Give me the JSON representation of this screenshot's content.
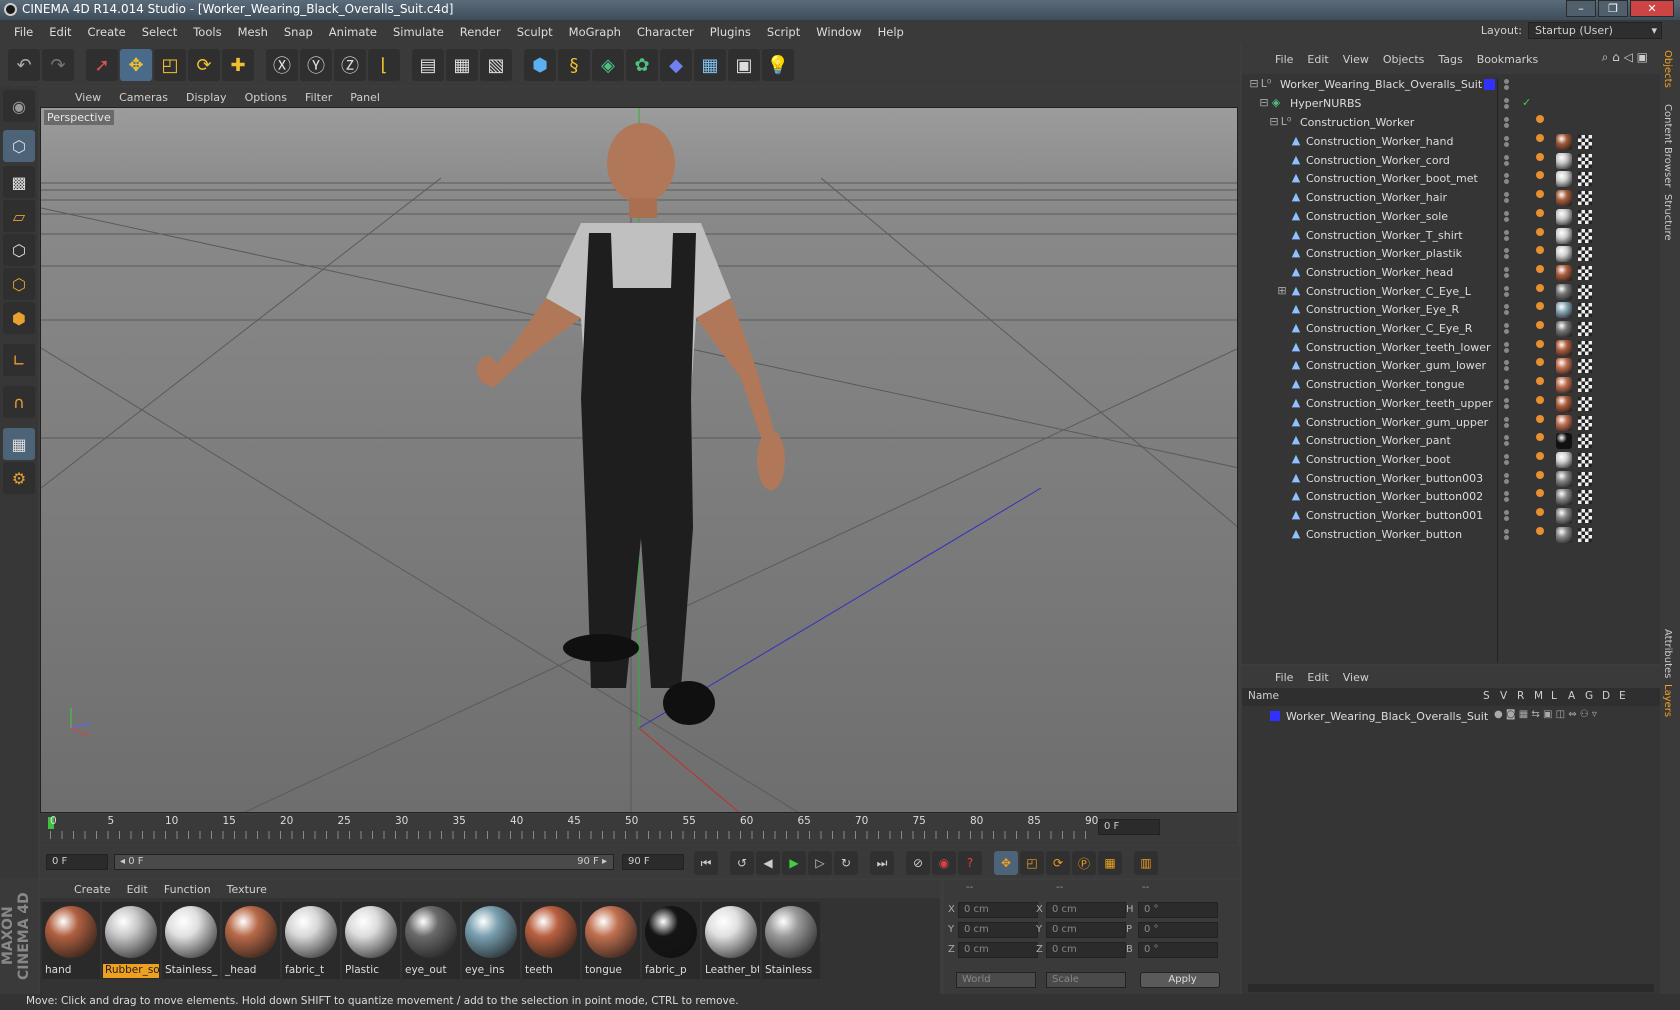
{
  "window": {
    "title": "CINEMA 4D R14.014 Studio - [Worker_Wearing_Black_Overalls_Suit.c4d]",
    "buttons": [
      "–",
      "❐",
      "✕"
    ]
  },
  "menu": [
    "File",
    "Edit",
    "Create",
    "Select",
    "Tools",
    "Mesh",
    "Snap",
    "Animate",
    "Simulate",
    "Render",
    "Sculpt",
    "MoGraph",
    "Character",
    "Plugins",
    "Script",
    "Window",
    "Help"
  ],
  "layout": {
    "label": "Layout:",
    "value": "Startup (User)"
  },
  "viewport": {
    "menu": [
      "View",
      "Cameras",
      "Display",
      "Options",
      "Filter",
      "Panel"
    ],
    "label": "Perspective"
  },
  "timeline": {
    "ticks": [
      "0",
      "5",
      "10",
      "15",
      "20",
      "25",
      "30",
      "35",
      "40",
      "45",
      "50",
      "55",
      "60",
      "65",
      "70",
      "75",
      "80",
      "85",
      "90"
    ],
    "end_field": "0 F"
  },
  "timecontrols": {
    "current": "0 F",
    "range_start": "◂ 0 F",
    "range_end": "90 F ▸",
    "max": "90 F"
  },
  "materials": {
    "menu": [
      "Create",
      "Edit",
      "Function",
      "Texture"
    ],
    "items": [
      {
        "name": "hand",
        "color": "#b06040"
      },
      {
        "name": "Rubber_so",
        "color": "#c8c8c8",
        "active": true
      },
      {
        "name": "Stainless_",
        "color": "#e0e0e0"
      },
      {
        "name": "_head",
        "color": "#b86a48"
      },
      {
        "name": "fabric_t",
        "color": "#d8d8d8"
      },
      {
        "name": "Plastic",
        "color": "#dcdcdc"
      },
      {
        "name": "eye_out",
        "color": "#6a6a6a"
      },
      {
        "name": "eye_ins",
        "color": "#7aa0b0"
      },
      {
        "name": "teeth",
        "color": "#b86040"
      },
      {
        "name": "tongue",
        "color": "#c07050"
      },
      {
        "name": "fabric_p",
        "color": "#151515"
      },
      {
        "name": "Leather_bt",
        "color": "#e0e0e0"
      },
      {
        "name": "Stainless",
        "color": "#9a9a9a"
      }
    ]
  },
  "coords": {
    "headers": [
      "--",
      "--",
      "--"
    ],
    "rows": [
      {
        "a": "X",
        "av": "0 cm",
        "b": "X",
        "bv": "0 cm",
        "c": "H",
        "cv": "0 °"
      },
      {
        "a": "Y",
        "av": "0 cm",
        "b": "Y",
        "bv": "0 cm",
        "c": "P",
        "cv": "0 °"
      },
      {
        "a": "Z",
        "av": "0 cm",
        "b": "Z",
        "bv": "0 cm",
        "c": "B",
        "cv": "0 °"
      }
    ],
    "world": "World",
    "scale": "Scale",
    "apply": "Apply"
  },
  "objects": {
    "menu": [
      "File",
      "Edit",
      "View",
      "Objects",
      "Tags",
      "Bookmarks"
    ],
    "root": "Worker_Wearing_Black_Overalls_Suit",
    "hyper": "HyperNURBS",
    "group": "Construction_Worker",
    "children": [
      {
        "name": "Construction_Worker_hand",
        "tag": "#a05a3a"
      },
      {
        "name": "Construction_Worker_cord",
        "tag": "#c8c8c8"
      },
      {
        "name": "Construction_Worker_boot_met",
        "tag": "#d0d0d0"
      },
      {
        "name": "Construction_Worker_hair",
        "tag": "#a86040"
      },
      {
        "name": "Construction_Worker_sole",
        "tag": "#c8c8c8"
      },
      {
        "name": "Construction_Worker_T_shirt",
        "tag": "#d0d0d0"
      },
      {
        "name": "Construction_Worker_plastik",
        "tag": "#d0d0d0"
      },
      {
        "name": "Construction_Worker_head",
        "tag": "#b06040"
      },
      {
        "name": "Construction_Worker_C_Eye_L",
        "tag": "#777777"
      },
      {
        "name": "Construction_Worker_Eye_R",
        "tag": "#8aa8b8"
      },
      {
        "name": "Construction_Worker_C_Eye_R",
        "tag": "#777777"
      },
      {
        "name": "Construction_Worker_teeth_lower",
        "tag": "#b06040"
      },
      {
        "name": "Construction_Worker_gum_lower",
        "tag": "#c07050"
      },
      {
        "name": "Construction_Worker_tongue",
        "tag": "#c07050"
      },
      {
        "name": "Construction_Worker_teeth_upper",
        "tag": "#b06040"
      },
      {
        "name": "Construction_Worker_gum_upper",
        "tag": "#c07050"
      },
      {
        "name": "Construction_Worker_pant",
        "tag": "#111111"
      },
      {
        "name": "Construction_Worker_boot",
        "tag": "#d0d0d0"
      },
      {
        "name": "Construction_Worker_button003",
        "tag": "#888888"
      },
      {
        "name": "Construction_Worker_button002",
        "tag": "#888888"
      },
      {
        "name": "Construction_Worker_button001",
        "tag": "#888888"
      },
      {
        "name": "Construction_Worker_button",
        "tag": "#888888"
      }
    ]
  },
  "layers": {
    "menu": [
      "File",
      "Edit",
      "View"
    ],
    "cols": [
      "Name",
      "S",
      "V",
      "R",
      "M",
      "L",
      "A",
      "G",
      "D",
      "E"
    ],
    "row": "Worker_Wearing_Black_Overalls_Suit"
  },
  "sidetabs": [
    "Objects",
    "Content Browser",
    "Structure",
    "Attributes",
    "Layers"
  ],
  "status": "Move: Click and drag to move elements. Hold down SHIFT to quantize movement / add to the selection in point mode, CTRL to remove.",
  "brand": "MAXON CINEMA 4D",
  "colors": {
    "accent": "#f0a020",
    "select": "#4d6478"
  }
}
